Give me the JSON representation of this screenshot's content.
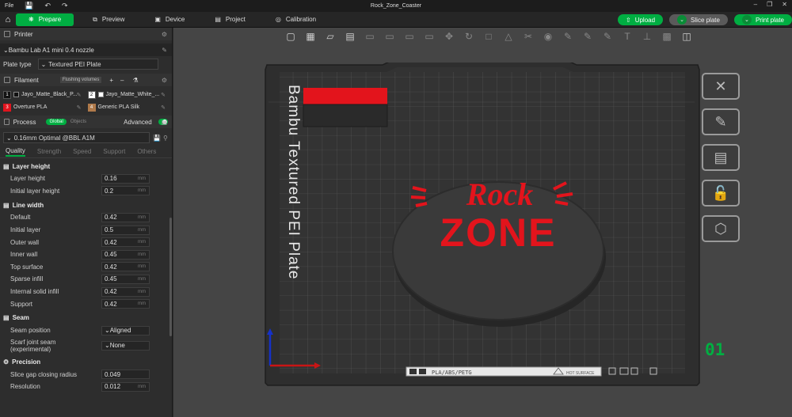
{
  "window": {
    "title": "Rock_Zone_Coaster",
    "menu": "File"
  },
  "tabs": [
    {
      "label": "Prepare"
    },
    {
      "label": "Preview"
    },
    {
      "label": "Device"
    },
    {
      "label": "Project"
    },
    {
      "label": "Calibration"
    }
  ],
  "actions": {
    "upload": "Upload",
    "slice": "Slice plate",
    "print": "Print plate"
  },
  "printer": {
    "header": "Printer",
    "name": "Bambu Lab A1 mini 0.4 nozzle",
    "plate_type_label": "Plate type",
    "plate_type": "Textured PEI Plate"
  },
  "filament": {
    "header": "Filament",
    "flushing": "Flushing volumes",
    "items": [
      {
        "num": "1",
        "name": "Jayo_Matte_Black_P...",
        "color": "#111111"
      },
      {
        "num": "2",
        "name": "Jayo_Matte_White_...",
        "color": "#ffffff"
      },
      {
        "num": "3",
        "name": "Overture PLA",
        "color": "#e0141e"
      },
      {
        "num": "4",
        "name": "Generic PLA Silk",
        "color": "#b07a4a"
      }
    ]
  },
  "process": {
    "header": "Process",
    "global": "Global",
    "objects": "Objects",
    "advanced": "Advanced",
    "preset": "0.16mm Optimal @BBL A1M",
    "tabs": [
      "Quality",
      "Strength",
      "Speed",
      "Support",
      "Others"
    ]
  },
  "groups": {
    "layer_height": {
      "title": "Layer height",
      "rows": [
        {
          "label": "Layer height",
          "value": "0.16",
          "unit": "mm"
        },
        {
          "label": "Initial layer height",
          "value": "0.2",
          "unit": "mm"
        }
      ]
    },
    "line_width": {
      "title": "Line width",
      "rows": [
        {
          "label": "Default",
          "value": "0.42",
          "unit": "mm"
        },
        {
          "label": "Initial layer",
          "value": "0.5",
          "unit": "mm"
        },
        {
          "label": "Outer wall",
          "value": "0.42",
          "unit": "mm"
        },
        {
          "label": "Inner wall",
          "value": "0.45",
          "unit": "mm"
        },
        {
          "label": "Top surface",
          "value": "0.42",
          "unit": "mm"
        },
        {
          "label": "Sparse infill",
          "value": "0.45",
          "unit": "mm"
        },
        {
          "label": "Internal solid infill",
          "value": "0.42",
          "unit": "mm"
        },
        {
          "label": "Support",
          "value": "0.42",
          "unit": "mm"
        }
      ]
    },
    "seam": {
      "title": "Seam",
      "rows": [
        {
          "label": "Seam position",
          "value": "Aligned"
        },
        {
          "label": "Scarf joint seam (experimental)",
          "value": "None"
        }
      ]
    },
    "precision": {
      "title": "Precision",
      "rows": [
        {
          "label": "Slice gap closing radius",
          "value": "0.049",
          "unit": ""
        },
        {
          "label": "Resolution",
          "value": "0.012",
          "unit": "mm"
        }
      ]
    }
  },
  "plate": {
    "side_text": "Bambu Textured PEI Plate",
    "logo_top": "Rock",
    "logo_bottom": "ZONE",
    "strip_text": "PLA/ABS/PETG",
    "strip_hot": "HOT SURFACE",
    "number": "01"
  },
  "colors": {
    "accent": "#00ae42",
    "logo_red": "#e3141c",
    "disc": "#3a3a3a"
  }
}
